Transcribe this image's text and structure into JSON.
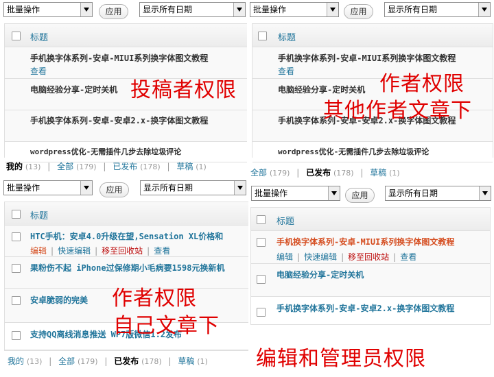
{
  "common": {
    "bulk_action": "批量操作",
    "apply": "应用",
    "date_filter": "显示所有日期",
    "title_header": "标题",
    "view": "查看",
    "edit": "编辑",
    "quick_edit": "快速编辑",
    "trash": "移至回收站"
  },
  "panel1": {
    "rows": [
      "手机换字体系列-安卓-MIUI系列换字体图文教程",
      "电脑经验分享-定时关机",
      "手机换字体系列-安卓-安卓2.x-换字体图文教程",
      "wordpress优化-无需插件几步去除垃圾评论"
    ],
    "status": {
      "mine": "我的",
      "mine_count": "(13)",
      "all": "全部",
      "all_count": "(179)",
      "published": "已发布",
      "published_count": "(178)",
      "draft": "草稿",
      "draft_count": "(1)"
    },
    "overlay": "投稿者权限"
  },
  "panel2": {
    "rows": [
      "手机换字体系列-安卓-MIUI系列换字体图文教程",
      "电脑经验分享-定时关机",
      "手机换字体系列-安卓-安卓2.x-换字体图文教程",
      "wordpress优化-无需插件几步去除垃圾评论"
    ],
    "status": {
      "all": "全部",
      "all_count": "(179)",
      "published": "已发布",
      "published_count": "(178)",
      "draft": "草稿",
      "draft_count": "(1)"
    },
    "overlay_1": "作者权限",
    "overlay_2": "其他作者文章下"
  },
  "panel3": {
    "rows": [
      "HTC手机：安卓4.0升级在望,Sensation XL价格和",
      "果粉伤不起 iPhone过保修期小毛病要1598元换新机",
      "安卓脆弱的完美",
      "支持QQ离线消息推送 WP7版微信1.2发布"
    ],
    "status": {
      "mine": "我的",
      "mine_count": "(13)",
      "all": "全部",
      "all_count": "(179)",
      "published": "已发布",
      "published_count": "(178)",
      "draft": "草稿",
      "draft_count": "(1)"
    },
    "overlay_1": "作者权限",
    "overlay_2": "自己文章下"
  },
  "panel4": {
    "rows": [
      "手机换字体系列-安卓-MIUI系列换字体图文教程",
      "电脑经验分享-定时关机",
      "手机换字体系列-安卓-安卓2.x-换字体图文教程"
    ],
    "overlay": "编辑和管理员权限"
  },
  "colors": {
    "link": "#21759b",
    "highlight": "#d54e21",
    "trash": "#bc0b0b",
    "overlay": "#e00000"
  }
}
